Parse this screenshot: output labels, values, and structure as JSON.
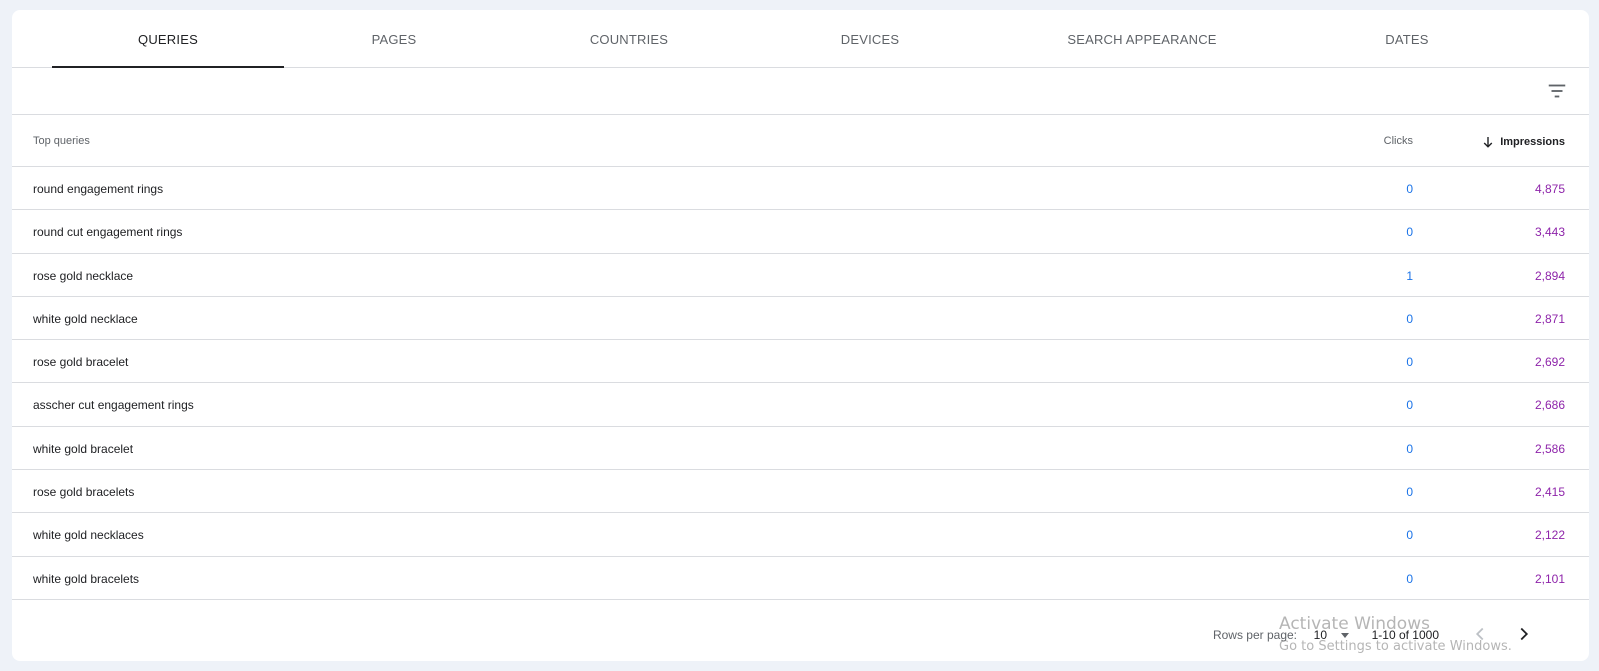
{
  "tabs": [
    {
      "label": "QUERIES",
      "active": true
    },
    {
      "label": "PAGES",
      "active": false
    },
    {
      "label": "COUNTRIES",
      "active": false
    },
    {
      "label": "DEVICES",
      "active": false
    },
    {
      "label": "SEARCH APPEARANCE",
      "active": false
    },
    {
      "label": "DATES",
      "active": false
    }
  ],
  "filter": {
    "icon": "filter-icon"
  },
  "table": {
    "headers": {
      "query": "Top queries",
      "clicks": "Clicks",
      "impressions": "Impressions",
      "sort_icon": "arrow-down-icon"
    },
    "rows": [
      {
        "query": "round engagement rings",
        "clicks": "0",
        "impressions": "4,875"
      },
      {
        "query": "round cut engagement rings",
        "clicks": "0",
        "impressions": "3,443"
      },
      {
        "query": "rose gold necklace",
        "clicks": "1",
        "impressions": "2,894"
      },
      {
        "query": "white gold necklace",
        "clicks": "0",
        "impressions": "2,871"
      },
      {
        "query": "rose gold bracelet",
        "clicks": "0",
        "impressions": "2,692"
      },
      {
        "query": "asscher cut engagement rings",
        "clicks": "0",
        "impressions": "2,686"
      },
      {
        "query": "white gold bracelet",
        "clicks": "0",
        "impressions": "2,586"
      },
      {
        "query": "rose gold bracelets",
        "clicks": "0",
        "impressions": "2,415"
      },
      {
        "query": "white gold necklaces",
        "clicks": "0",
        "impressions": "2,122"
      },
      {
        "query": "white gold bracelets",
        "clicks": "0",
        "impressions": "2,101"
      }
    ]
  },
  "pagination": {
    "rows_per_page_label": "Rows per page:",
    "rows_per_page_value": "10",
    "range": "1-10 of 1000"
  },
  "watermark": {
    "title": "Activate Windows",
    "subtitle": "Go to Settings to activate Windows."
  },
  "colors": {
    "clicks": "#1a73e8",
    "impressions": "#8e24aa",
    "active_tab_underline": "#202124"
  }
}
